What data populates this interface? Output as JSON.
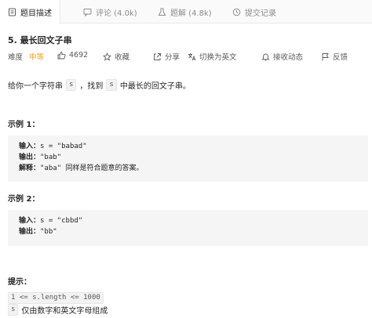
{
  "tabs": [
    {
      "label": "题目描述",
      "icon": "document-icon"
    },
    {
      "label": "评论 (4.0k)",
      "icon": "comment-icon"
    },
    {
      "label": "题解 (4.8k)",
      "icon": "flask-icon"
    },
    {
      "label": "提交记录",
      "icon": "clock-icon"
    }
  ],
  "problem": {
    "title": "5. 最长回文子串",
    "difficulty_label": "难度",
    "difficulty": "中等",
    "likes": "4692",
    "actions": {
      "favorite": "收藏",
      "share": "分享",
      "translate": "切换为英文",
      "follow": "接收动态",
      "feedback": "反馈"
    },
    "description": {
      "part1": "给你一个字符串",
      "var1": "s",
      "part2": "，找到",
      "var2": "s",
      "part3": "中最长的回文子串。"
    }
  },
  "examples": [
    {
      "heading": "示例 1：",
      "input_label": "输入：",
      "input": "s = \"babad\"",
      "output_label": "输出：",
      "output": "\"bab\"",
      "explain_label": "解释：",
      "explain": "\"aba\" 同样是符合题意的答案。"
    },
    {
      "heading": "示例 2：",
      "input_label": "输入：",
      "input": "s = \"cbbd\"",
      "output_label": "输出：",
      "output": "\"bb\""
    }
  ],
  "hints": {
    "heading": "提示：",
    "constraint1": "1 <= s.length <= 1000",
    "constraint2_code": "s",
    "constraint2_text": "仅由数字和英文字母组成"
  },
  "colors": {
    "difficulty_medium": "#f79c1c",
    "code_block_bg": "#f5f5f5"
  }
}
